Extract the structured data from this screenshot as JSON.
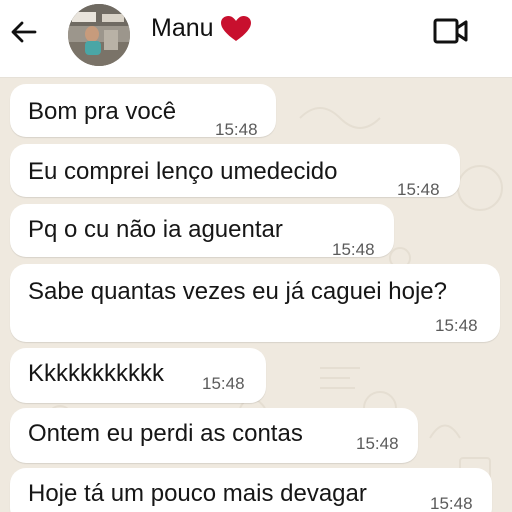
{
  "header": {
    "contact_name": "Manu",
    "back_icon": "arrow-left-icon",
    "status_emoji": "red-heart-icon",
    "video_icon": "video-call-icon",
    "heart_color": "#c8102e"
  },
  "messages": [
    {
      "text": "Bom pra você",
      "time": "15:48"
    },
    {
      "text": "Eu comprei lenço umedecido",
      "time": "15:48"
    },
    {
      "text": "Pq o cu não ia aguentar",
      "time": "15:48"
    },
    {
      "text": "Sabe quantas vezes eu já caguei hoje?",
      "time": "15:48"
    },
    {
      "text": "Kkkkkkkkkkk",
      "time": "15:48"
    },
    {
      "text": "Ontem eu perdi as contas",
      "time": "15:48"
    },
    {
      "text": "Hoje tá um pouco mais devagar",
      "time": "15:48"
    }
  ]
}
